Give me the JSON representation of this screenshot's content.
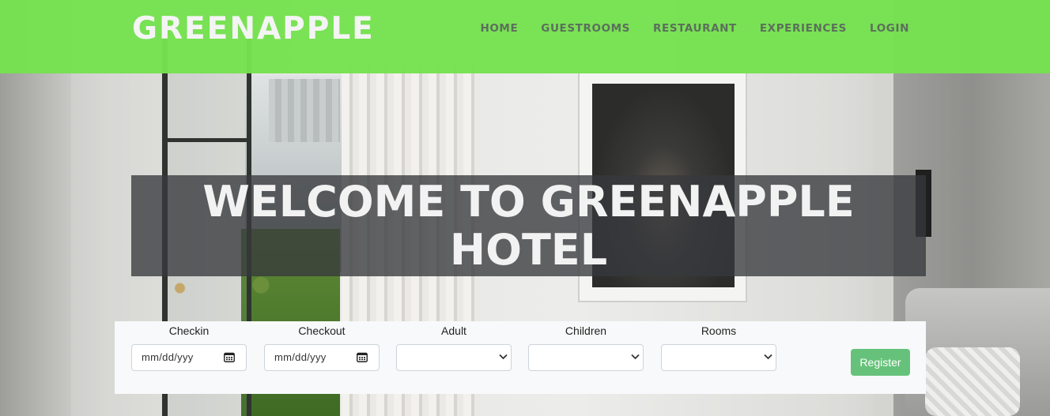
{
  "header": {
    "brand": "GREENAPPLE",
    "nav": [
      "HOME",
      "GUESTROOMS",
      "RESTAURANT",
      "EXPERIENCES",
      "LOGIN"
    ]
  },
  "hero": {
    "title": "WELCOME TO GREENAPPLE HOTEL"
  },
  "booking": {
    "checkin": {
      "label": "Checkin",
      "value": "mm/dd/yyy"
    },
    "checkout": {
      "label": "Checkout",
      "value": "mm/dd/yyy"
    },
    "adult": {
      "label": "Adult",
      "value": ""
    },
    "children": {
      "label": "Children",
      "value": ""
    },
    "rooms": {
      "label": "Rooms",
      "value": ""
    },
    "register_label": "Register"
  },
  "colors": {
    "header_green": "#75e150",
    "register_green": "#66c27a",
    "banner_overlay": "#37393c",
    "form_background": "#f8f9fa"
  },
  "icons": [
    "calendar-icon",
    "chevron-down-icon"
  ]
}
